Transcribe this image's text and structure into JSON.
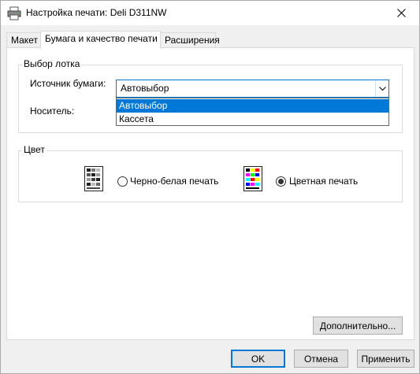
{
  "window": {
    "title": "Настройка печати: Deli D311NW"
  },
  "tabs": [
    {
      "label": "Макет"
    },
    {
      "label": "Бумага и качество печати"
    },
    {
      "label": "Расширения"
    }
  ],
  "tray_group": {
    "title": "Выбор лотка",
    "source_label": "Источник бумаги:",
    "source_value": "Автовыбор",
    "source_options": [
      "Автовыбор",
      "Кассета"
    ],
    "media_label": "Носитель:"
  },
  "color_group": {
    "title": "Цвет",
    "bw_label": "Черно-белая печать",
    "color_label": "Цветная печать",
    "selected": "color"
  },
  "buttons": {
    "advanced": "Дополнительно...",
    "ok": "OK",
    "cancel": "Отмена",
    "apply": "Применить"
  }
}
